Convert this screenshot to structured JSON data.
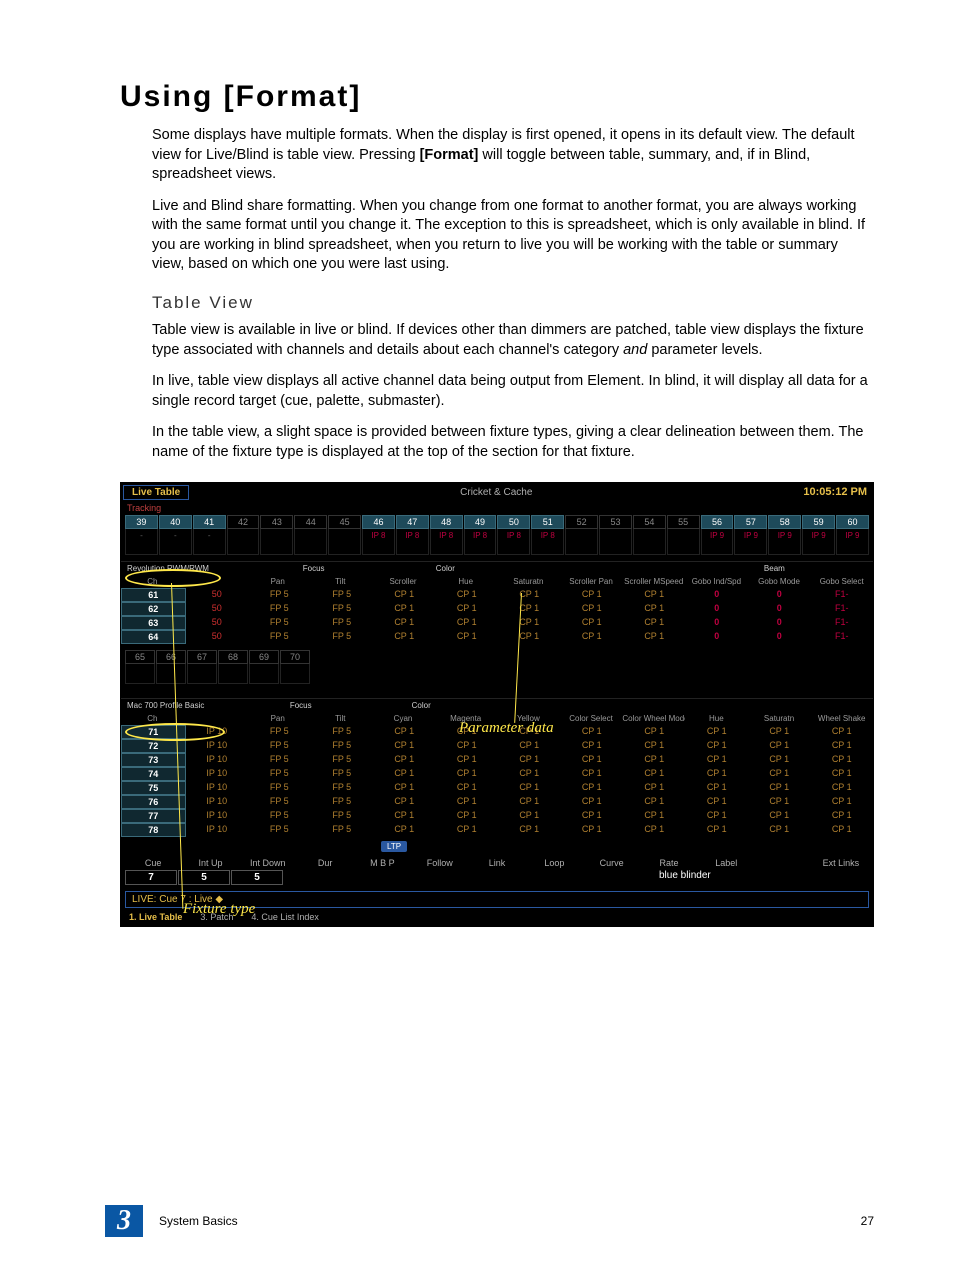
{
  "heading": "Using [Format]",
  "para1_a": "Some displays have multiple formats. When the display is first opened, it opens in its default view. The default view for Live/Blind is table view. Pressing ",
  "para1_bold": "[Format]",
  "para1_b": " will toggle between table, summary, and, if in Blind, spreadsheet views.",
  "para2": "Live and Blind share formatting. When you change from one format to another format, you are always working with the same format until you change it. The exception to this is spreadsheet, which is only available in blind. If you are working in blind spreadsheet, when you return to live you will be working with the table or summary view, based on which one you were last using.",
  "sub1": "Table View",
  "para3_a": "Table view is available in live or blind. If devices other than dimmers are patched, table view displays the fixture type associated with channels and details about each channel's category ",
  "para3_italic": "and",
  "para3_b": " parameter levels.",
  "para4": "In live, table view displays all active channel data being output from Element. In blind, it will display all data for a single record target (cue, palette, submaster).",
  "para5": "In the table view, a slight space is provided between fixture types, giving a clear delineation between them. The name of the fixture type is displayed at the top of the section for that fixture.",
  "figure": {
    "tab": "Live Table",
    "center": "Cricket & Cache",
    "time": "10:05:12 PM",
    "tracking": "Tracking",
    "strip1": {
      "nums": [
        "39",
        "40",
        "41",
        "42",
        "43",
        "44",
        "45",
        "46",
        "47",
        "48",
        "49",
        "50",
        "51",
        "52",
        "53",
        "54",
        "55",
        "56",
        "57",
        "58",
        "59",
        "60"
      ],
      "active": [
        true,
        true,
        true,
        false,
        false,
        false,
        false,
        true,
        true,
        true,
        true,
        true,
        true,
        false,
        false,
        false,
        false,
        true,
        true,
        true,
        true,
        true
      ],
      "body_dash": [
        "-",
        "-",
        "-",
        "",
        "",
        "",
        "",
        "",
        "",
        "",
        "",
        "",
        "",
        "",
        "",
        "",
        "",
        "",
        "",
        "",
        "",
        ""
      ],
      "body_ip": [
        "",
        "",
        "",
        "",
        "",
        "",
        "",
        "IP 8",
        "IP 8",
        "IP 8",
        "IP 8",
        "IP 8",
        "IP 8",
        "",
        "",
        "",
        "",
        "IP 9",
        "IP 9",
        "IP 9",
        "IP 9",
        "IP 9"
      ]
    },
    "section1": {
      "fixture": "Revolution RWM/RWM",
      "cats": [
        "",
        "Focus",
        "",
        "Color",
        "",
        "",
        "",
        "",
        "Beam",
        ""
      ],
      "params": [
        "Ch",
        "",
        "Pan",
        "Tilt",
        "Scroller",
        "Hue",
        "Saturatn",
        "Scroller Pan",
        "Scroller MSpeed",
        "Gobo Ind/Spd",
        "Gobo Mode",
        "Gobo Select"
      ],
      "rows": [
        {
          "ch": "61",
          "v": [
            "",
            "50",
            "FP 5",
            "FP 5",
            "CP 1",
            "CP 1",
            "CP 1",
            "CP 1",
            "CP 1",
            "0",
            "0",
            "F1-"
          ]
        },
        {
          "ch": "62",
          "v": [
            "",
            "50",
            "FP 5",
            "FP 5",
            "CP 1",
            "CP 1",
            "CP 1",
            "CP 1",
            "CP 1",
            "0",
            "0",
            "F1-"
          ]
        },
        {
          "ch": "63",
          "v": [
            "",
            "50",
            "FP 5",
            "FP 5",
            "CP 1",
            "CP 1",
            "CP 1",
            "CP 1",
            "CP 1",
            "0",
            "0",
            "F1-"
          ]
        },
        {
          "ch": "64",
          "v": [
            "",
            "50",
            "FP 5",
            "FP 5",
            "CP 1",
            "CP 1",
            "CP 1",
            "CP 1",
            "CP 1",
            "0",
            "0",
            "F1-"
          ]
        }
      ]
    },
    "strip2_nums": [
      "65",
      "66",
      "67",
      "68",
      "69",
      "70"
    ],
    "section2": {
      "fixture": "Mac 700 Profile Basic",
      "cats": [
        "",
        "Focus",
        "",
        "Color",
        "",
        "",
        "",
        "",
        "",
        "",
        ""
      ],
      "params": [
        "Ch",
        "",
        "Pan",
        "Tilt",
        "Cyan",
        "Magenta",
        "Yellow",
        "Color Select",
        "Color Wheel Mode",
        "Hue",
        "Saturatn",
        "Wheel Shake"
      ],
      "rows": [
        {
          "ch": "71",
          "v": [
            "",
            "IP 10",
            "FP 5",
            "FP 5",
            "CP 1",
            "CP 1",
            "CP 1",
            "CP 1",
            "CP 1",
            "CP 1",
            "CP 1",
            "CP 1"
          ]
        },
        {
          "ch": "72",
          "v": [
            "",
            "IP 10",
            "FP 5",
            "FP 5",
            "CP 1",
            "CP 1",
            "CP 1",
            "CP 1",
            "CP 1",
            "CP 1",
            "CP 1",
            "CP 1"
          ]
        },
        {
          "ch": "73",
          "v": [
            "",
            "IP 10",
            "FP 5",
            "FP 5",
            "CP 1",
            "CP 1",
            "CP 1",
            "CP 1",
            "CP 1",
            "CP 1",
            "CP 1",
            "CP 1"
          ]
        },
        {
          "ch": "74",
          "v": [
            "",
            "IP 10",
            "FP 5",
            "FP 5",
            "CP 1",
            "CP 1",
            "CP 1",
            "CP 1",
            "CP 1",
            "CP 1",
            "CP 1",
            "CP 1"
          ]
        },
        {
          "ch": "75",
          "v": [
            "",
            "IP 10",
            "FP 5",
            "FP 5",
            "CP 1",
            "CP 1",
            "CP 1",
            "CP 1",
            "CP 1",
            "CP 1",
            "CP 1",
            "CP 1"
          ]
        },
        {
          "ch": "76",
          "v": [
            "",
            "IP 10",
            "FP 5",
            "FP 5",
            "CP 1",
            "CP 1",
            "CP 1",
            "CP 1",
            "CP 1",
            "CP 1",
            "CP 1",
            "CP 1"
          ]
        },
        {
          "ch": "77",
          "v": [
            "",
            "IP 10",
            "FP 5",
            "FP 5",
            "CP 1",
            "CP 1",
            "CP 1",
            "CP 1",
            "CP 1",
            "CP 1",
            "CP 1",
            "CP 1"
          ]
        },
        {
          "ch": "78",
          "v": [
            "",
            "IP 10",
            "FP 5",
            "FP 5",
            "CP 1",
            "CP 1",
            "CP 1",
            "CP 1",
            "CP 1",
            "CP 1",
            "CP 1",
            "CP 1"
          ]
        }
      ]
    },
    "callouts": {
      "param_data": "Parameter data",
      "fixture_type": "Fixture type"
    },
    "ltp": "LTP",
    "cue_headers": [
      "Cue",
      "Int Up",
      "Int Down",
      "Dur",
      "M B P",
      "Follow",
      "Link",
      "Loop",
      "Curve",
      "Rate",
      "Label",
      "",
      "Ext Links"
    ],
    "cue_values": {
      "cue": "7",
      "intup": "5",
      "intdown": "5",
      "label": "blue blinder"
    },
    "cmd_line": "LIVE: Cue  7 :  Live ◆",
    "footer_tabs": [
      "1. Live Table",
      "3. Patch",
      "4. Cue List Index"
    ]
  },
  "footer": {
    "chapter": "3",
    "section": "System Basics",
    "page": "27"
  }
}
